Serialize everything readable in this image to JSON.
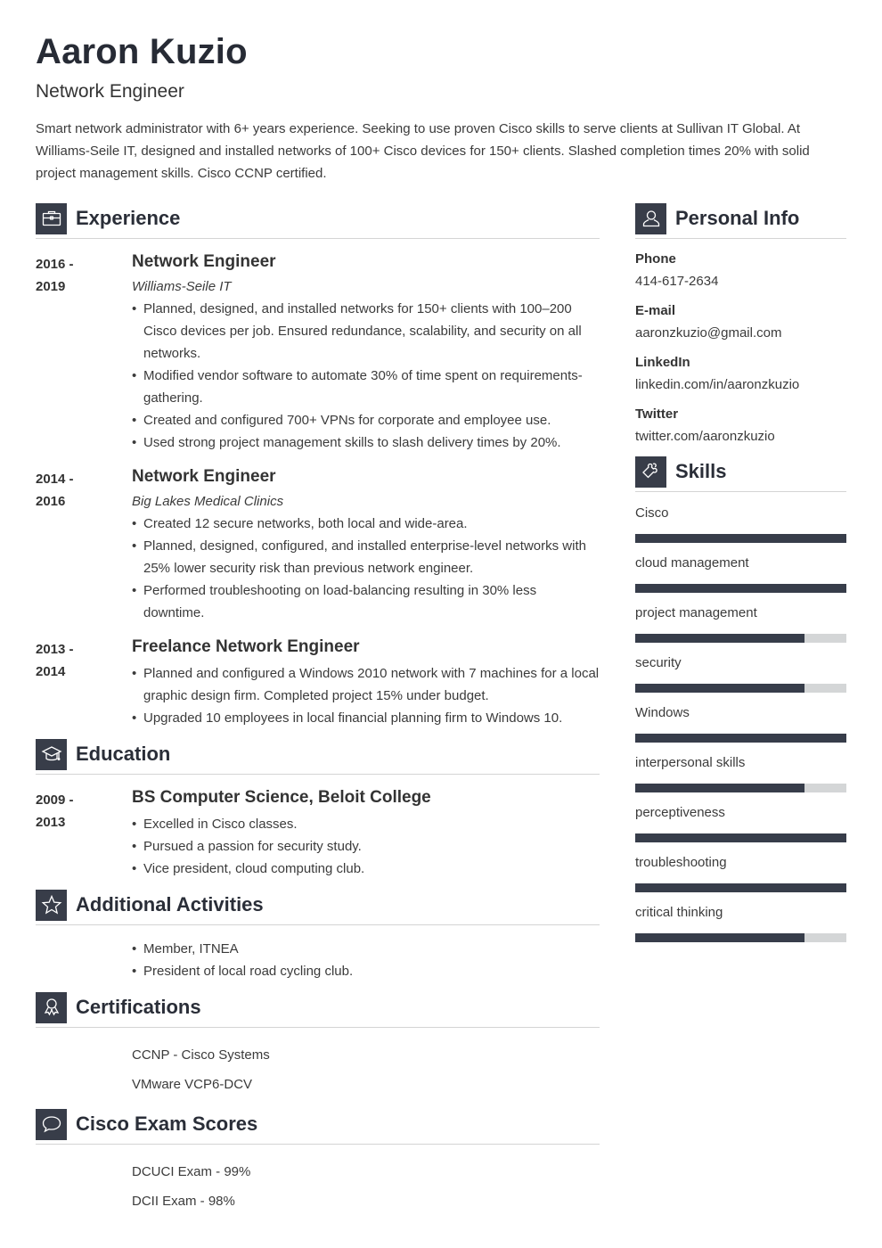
{
  "header": {
    "name": "Aaron Kuzio",
    "title": "Network Engineer",
    "summary": "Smart network administrator with 6+ years experience. Seeking to use proven Cisco skills to serve clients at Sullivan IT Global. At Williams-Seile IT, designed and installed networks of 100+ Cisco devices for 150+ clients. Slashed completion times 20% with solid project management skills. Cisco CCNP certified."
  },
  "experience": {
    "heading": "Experience",
    "icon": "briefcase-icon",
    "entries": [
      {
        "dates_start": "2016 -",
        "dates_end": "2019",
        "role": "Network Engineer",
        "company": "Williams-Seile IT",
        "bullets": [
          "Planned, designed, and installed networks for 150+ clients with 100–200 Cisco devices per job. Ensured redundance, scalability, and security on all networks.",
          "Modified vendor software to automate 30% of time spent on requirements-gathering.",
          "Created and configured 700+ VPNs for corporate and employee use.",
          "Used strong project management skills to slash delivery times by 20%."
        ]
      },
      {
        "dates_start": "2014 -",
        "dates_end": "2016",
        "role": "Network Engineer",
        "company": "Big Lakes Medical Clinics",
        "bullets": [
          "Created 12 secure networks, both local and wide-area.",
          "Planned, designed, configured, and installed enterprise-level networks with 25% lower security risk than previous network engineer.",
          "Performed troubleshooting on load-balancing resulting in 30% less downtime."
        ]
      },
      {
        "dates_start": "2013 -",
        "dates_end": "2014",
        "role": "Freelance Network Engineer",
        "bullets": [
          "Planned and configured a Windows 2010 network with 7 machines for a local graphic design firm. Completed project 15% under budget.",
          "Upgraded 10 employees in local financial planning firm to Windows 10."
        ]
      }
    ]
  },
  "education": {
    "heading": "Education",
    "icon": "graduation-cap-icon",
    "entries": [
      {
        "dates_start": "2009 -",
        "dates_end": "2013",
        "degree": "BS Computer Science, Beloit College",
        "bullets": [
          "Excelled in Cisco classes.",
          "Pursued a passion for security study.",
          "Vice president, cloud computing club."
        ]
      }
    ]
  },
  "activities": {
    "heading": "Additional Activities",
    "icon": "star-icon",
    "bullets": [
      "Member, ITNEA",
      "President of local road cycling club."
    ]
  },
  "certifications": {
    "heading": "Certifications",
    "icon": "award-ribbon-icon",
    "items": [
      "CCNP - Cisco Systems",
      "VMware VCP6-DCV"
    ]
  },
  "exam_scores": {
    "heading": "Cisco Exam Scores",
    "icon": "speech-bubble-icon",
    "items": [
      "DCUCI Exam - 99%",
      "DCII Exam - 98%"
    ]
  },
  "personal_info": {
    "heading": "Personal Info",
    "icon": "person-icon",
    "fields": [
      {
        "label": "Phone",
        "value": "414-617-2634"
      },
      {
        "label": "E-mail",
        "value": "aaronzkuzio@gmail.com"
      },
      {
        "label": "LinkedIn",
        "value": "linkedin.com/in/aaronzkuzio"
      },
      {
        "label": "Twitter",
        "value": "twitter.com/aaronzkuzio"
      }
    ]
  },
  "skills": {
    "heading": "Skills",
    "icon": "puzzle-piece-icon",
    "items": [
      {
        "name": "Cisco",
        "level": 1.0
      },
      {
        "name": "cloud management",
        "level": 1.0
      },
      {
        "name": "project management",
        "level": 0.8
      },
      {
        "name": "security",
        "level": 0.8
      },
      {
        "name": "Windows",
        "level": 1.0
      },
      {
        "name": "interpersonal skills",
        "level": 0.8
      },
      {
        "name": "perceptiveness",
        "level": 1.0
      },
      {
        "name": "troubleshooting",
        "level": 1.0
      },
      {
        "name": "critical thinking",
        "level": 0.8
      }
    ]
  },
  "colors": {
    "accent": "#383d49",
    "bar_track": "#d4d6d7",
    "text": "#3b3b3b",
    "heading": "#2a2e38"
  }
}
